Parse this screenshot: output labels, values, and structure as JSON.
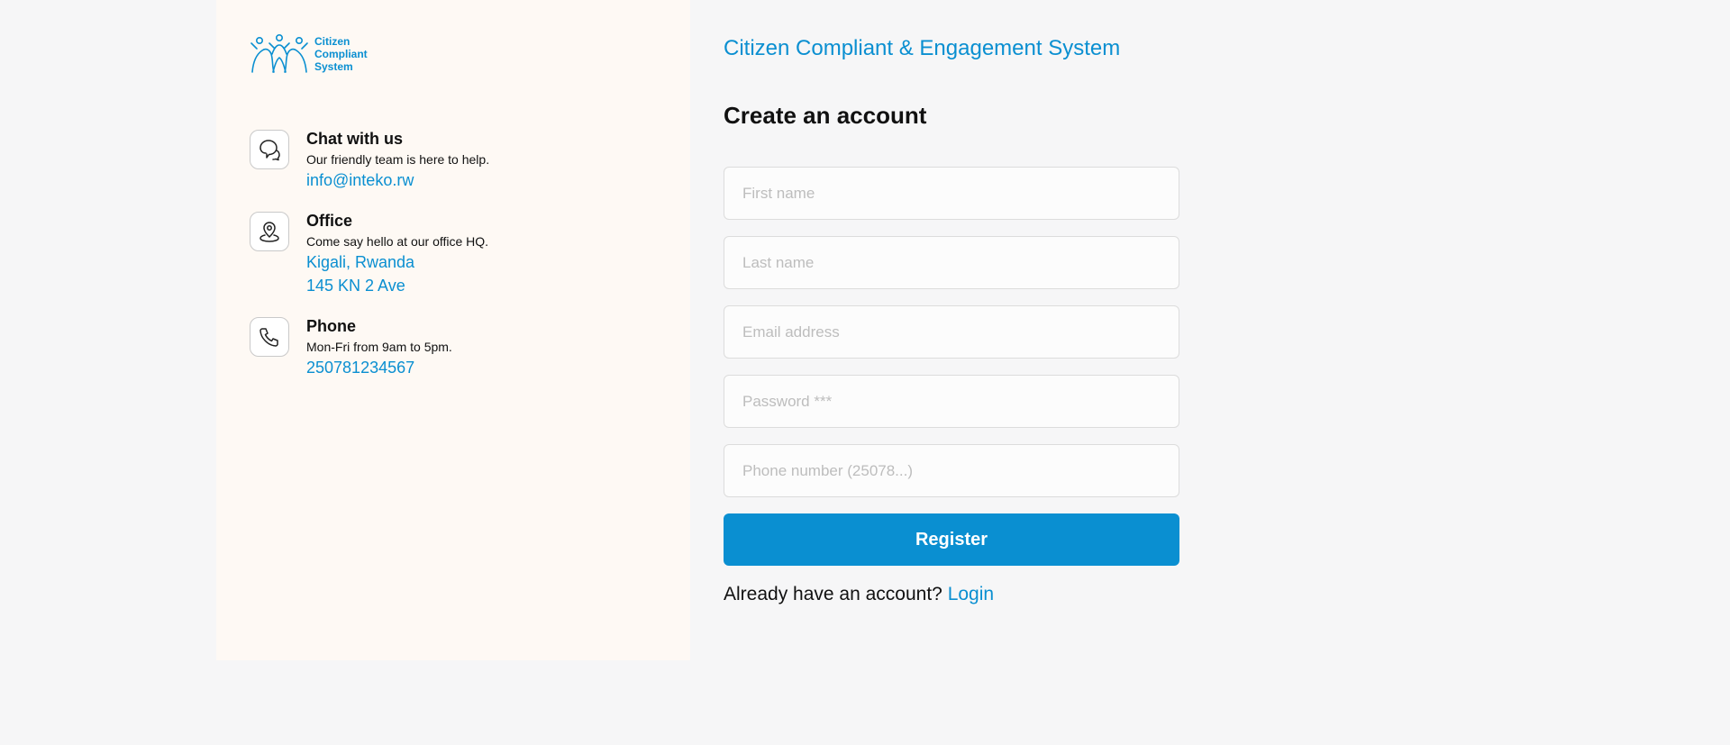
{
  "brand": {
    "logo_text": [
      "Citizen",
      "Compliant",
      "System"
    ],
    "accent_color": "#0a8fd1",
    "logo_icon": "people-group-icon"
  },
  "contacts": [
    {
      "icon": "chat-bubbles-icon",
      "title": "Chat with us",
      "description": "Our friendly team is here to help.",
      "links": [
        "info@inteko.rw"
      ]
    },
    {
      "icon": "map-pin-icon",
      "title": "Office",
      "description": "Come say hello at our office HQ.",
      "links": [
        "Kigali, Rwanda",
        "145 KN 2 Ave"
      ]
    },
    {
      "icon": "phone-icon",
      "title": "Phone",
      "description": "Mon-Fri from 9am to 5pm.",
      "links": [
        "250781234567"
      ]
    }
  ],
  "form": {
    "system_title": "Citizen Compliant & Engagement System",
    "title": "Create an account",
    "fields": {
      "first_name": {
        "placeholder": "First name",
        "value": ""
      },
      "last_name": {
        "placeholder": "Last name",
        "value": ""
      },
      "email": {
        "placeholder": "Email address",
        "value": ""
      },
      "password": {
        "placeholder": "Password ***",
        "value": ""
      },
      "phone": {
        "placeholder": "Phone number (25078...)",
        "value": ""
      }
    },
    "submit_label": "Register",
    "login_prompt": "Already have an account?",
    "login_label": "Login"
  }
}
